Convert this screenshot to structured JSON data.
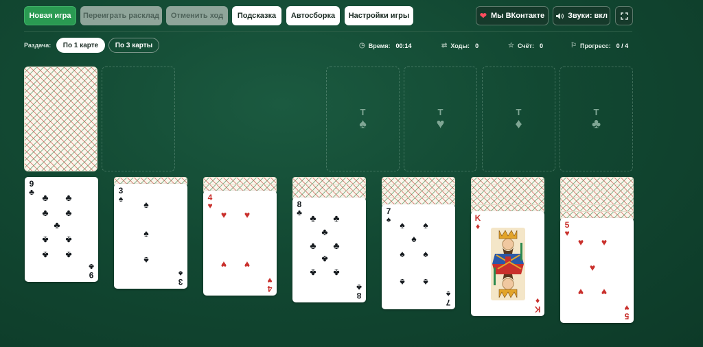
{
  "toolbar": {
    "new_game": "Новая игра",
    "replay": "Переиграть расклад",
    "undo": "Отменить ход",
    "hint": "Подсказка",
    "autocollect": "Автосборка",
    "settings": "Настройки игры",
    "vk": "Мы ВКонтакте",
    "sound": "Звуки: вкл"
  },
  "deal": {
    "label": "Раздача:",
    "one": "По 1 карте",
    "three": "По 3 карты",
    "selected": "По 1 карте"
  },
  "stats": {
    "time_label": "Время:",
    "time": "00:14",
    "moves_label": "Ходы:",
    "moves": "0",
    "score_label": "Счёт:",
    "score": "0",
    "progress_label": "Прогресс:",
    "progress": "0 / 4"
  },
  "foundations": [
    {
      "rank": "Т",
      "suit": "♠"
    },
    {
      "rank": "Т",
      "suit": "♥"
    },
    {
      "rank": "Т",
      "suit": "♦"
    },
    {
      "rank": "Т",
      "suit": "♣"
    }
  ],
  "tableau": [
    {
      "hidden": 0,
      "card": {
        "rank": "9",
        "suit": "♣",
        "color": "black"
      }
    },
    {
      "hidden": 1,
      "card": {
        "rank": "3",
        "suit": "♠",
        "color": "black"
      }
    },
    {
      "hidden": 2,
      "card": {
        "rank": "4",
        "suit": "♥",
        "color": "red"
      }
    },
    {
      "hidden": 3,
      "card": {
        "rank": "8",
        "suit": "♣",
        "color": "black"
      }
    },
    {
      "hidden": 4,
      "card": {
        "rank": "7",
        "suit": "♠",
        "color": "black"
      }
    },
    {
      "hidden": 5,
      "card": {
        "rank": "K",
        "suit": "♦",
        "color": "red",
        "face": "king"
      }
    },
    {
      "hidden": 6,
      "card": {
        "rank": "5",
        "suit": "♥",
        "color": "red"
      }
    }
  ],
  "colors": {
    "accent": "#2a9a52",
    "table": "#124832",
    "red_suit": "#c9302c",
    "black_suit": "#151a1e"
  },
  "icons": [
    "heart-icon",
    "speaker-icon",
    "fullscreen-icon",
    "clock-icon",
    "swap-arrows-icon",
    "star-icon",
    "flag-icon"
  ]
}
